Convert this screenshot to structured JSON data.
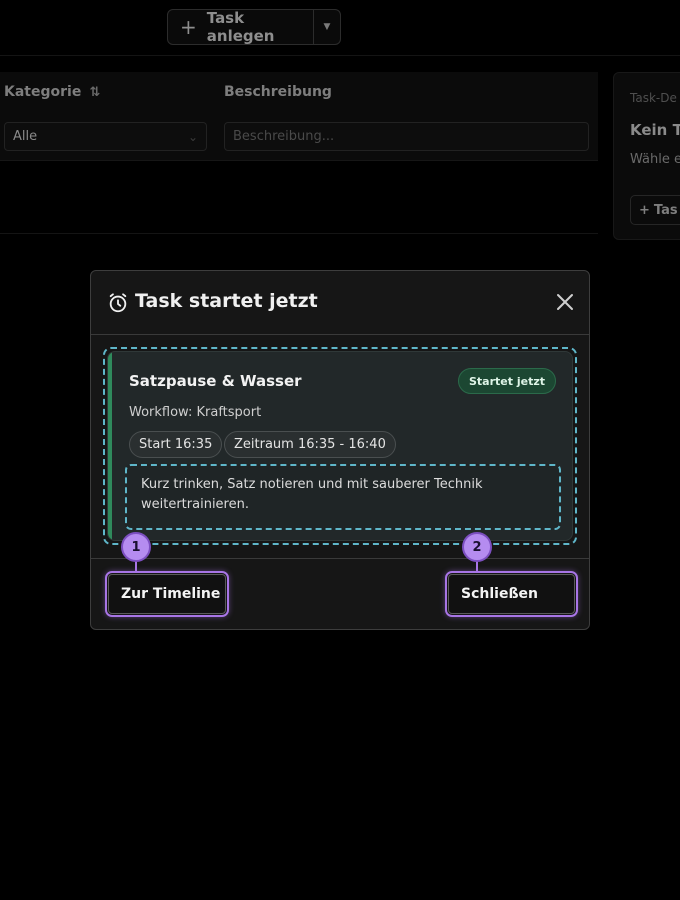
{
  "toolbar": {
    "add_task_label": "Task anlegen",
    "add_icon": "plus-icon",
    "dropdown_icon": "caret-down-icon"
  },
  "filters": {
    "category_label": "Kategorie",
    "category_value": "Alle",
    "description_label": "Beschreibung",
    "description_placeholder": "Beschreibung..."
  },
  "detail_panel": {
    "header": "Task-De",
    "title": "Kein Ta",
    "text": "Wähle e an.",
    "button_label": "Tas"
  },
  "modal": {
    "title": "Task startet jetzt",
    "title_icon": "alarm-clock-icon",
    "close_icon": "close-icon",
    "task": {
      "title": "Satzpause & Wasser",
      "status": "Startet jetzt",
      "workflow": "Workflow: Kraftsport",
      "start": "Start 16:35",
      "range": "Zeitraum 16:35 - 16:40",
      "description": "Kurz trinken, Satz notieren und mit sauberer Technik weitertrainieren."
    },
    "buttons": {
      "timeline": "Zur Timeline",
      "close": "Schließen"
    },
    "markers": [
      "1",
      "2"
    ]
  },
  "colors": {
    "highlight": "#a875e6",
    "dashed_outline": "#5fb6c9",
    "status_badge": "#1c4732",
    "accent_bar": "#2f8a5c"
  }
}
